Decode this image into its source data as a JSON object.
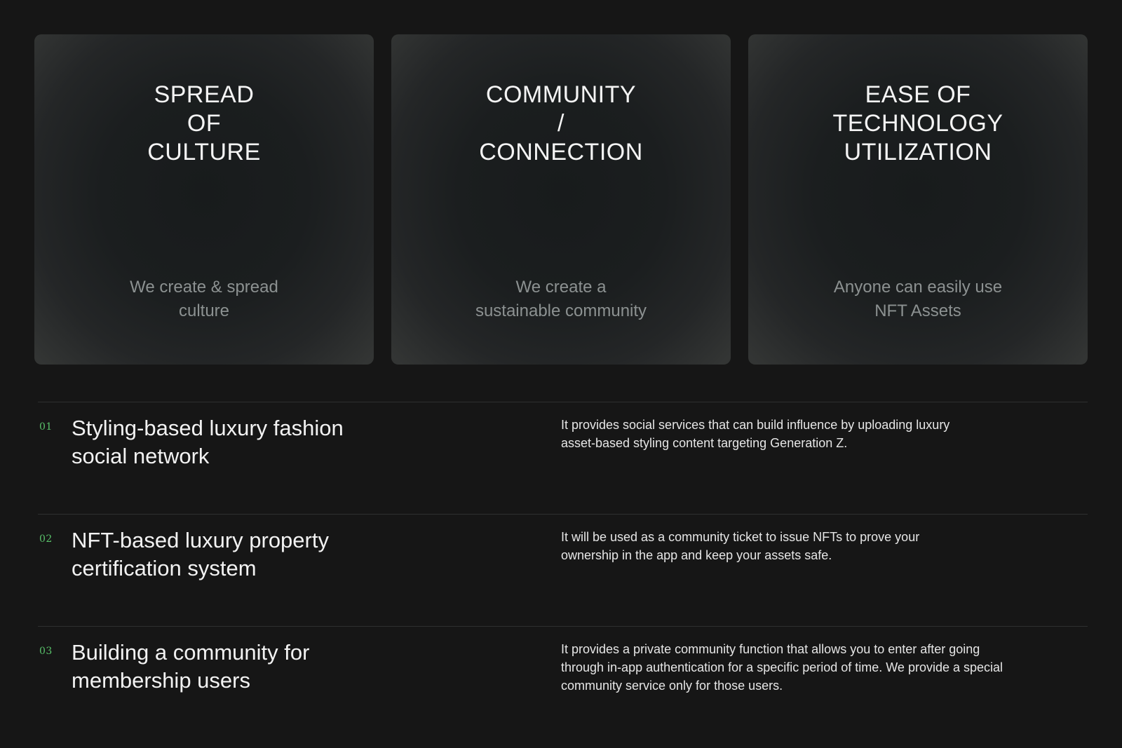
{
  "cards": [
    {
      "title": "SPREAD\nOF\nCULTURE",
      "description": "We create & spread\nculture"
    },
    {
      "title": "COMMUNITY\n/\nCONNECTION",
      "description": "We create a\nsustainable community"
    },
    {
      "title": "EASE OF\nTECHNOLOGY\nUTILIZATION",
      "description": "Anyone can easily use\nNFT Assets"
    }
  ],
  "features": [
    {
      "number": "01",
      "title": "Styling-based luxury fashion\nsocial network",
      "description": "It provides social services that can build influence by uploading luxury\nasset-based styling content targeting Generation Z."
    },
    {
      "number": "02",
      "title": "NFT-based luxury property\ncertification system",
      "description": "It will be used as a community ticket to issue NFTs to prove your\nownership in the app and keep your assets safe."
    },
    {
      "number": "03",
      "title": "Building a community for\nmembership users",
      "description": "It provides a private community function that allows you to enter after going\nthrough in-app authentication for a specific period of time. We provide a special\ncommunity service only for those users."
    }
  ],
  "colors": {
    "background": "#161616",
    "accent_number": "#59c26a",
    "card_description": "#8c9191",
    "divider": "#2e3030"
  }
}
